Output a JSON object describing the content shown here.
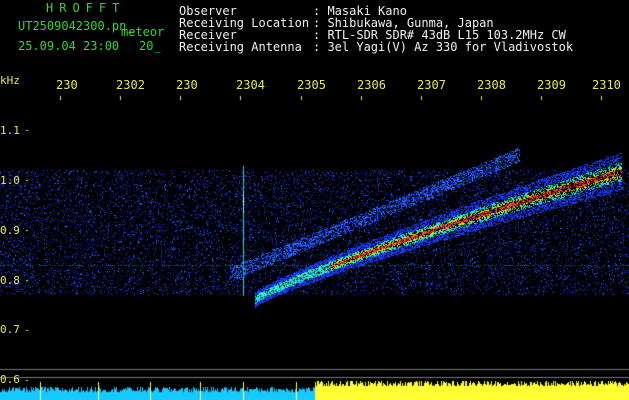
{
  "header": {
    "station_code": "HROFFT",
    "file_name": "UT2509042300.pn_",
    "file_label": "meteor",
    "date_time": "25.09.04 23:00",
    "counter": "20_",
    "fields": [
      {
        "label": "Observer",
        "value": ": Masaki Kano"
      },
      {
        "label": "Receiving Location",
        "value": ": Shibukawa, Gunma, Japan"
      },
      {
        "label": "Receiver",
        "value": ": RTL-SDR SDR# 43dB L15 103.2MHz CW"
      },
      {
        "label": "Receiving Antenna",
        "value": ": 3el Yagi(V) Az 330 for Vladivostok"
      }
    ]
  },
  "axes": {
    "y_unit": "kHz",
    "y_ticks": [
      "1.1",
      "1.0",
      "0.9",
      "0.8",
      "0.7",
      "0.6"
    ],
    "x_ticks": [
      "230",
      "230",
      "230",
      "230",
      "230",
      "230",
      "230",
      "230",
      "230",
      "2310"
    ],
    "x_tick_suffixes": [
      "",
      "2",
      "",
      "4",
      "5",
      "6",
      "7",
      "8",
      "9",
      ""
    ]
  },
  "colors": {
    "background": "#000000",
    "header_green": "#35d535",
    "header_white": "#f0f0f0",
    "axis_yellow": "#e8e85a",
    "meteor_trail": "#ff2a2a",
    "noise_blue": "#1b3cff",
    "noise_cyan": "#1fd6ff",
    "baseline_yellow": "#ffff33",
    "baseline_cyan": "#17c9ff"
  }
}
